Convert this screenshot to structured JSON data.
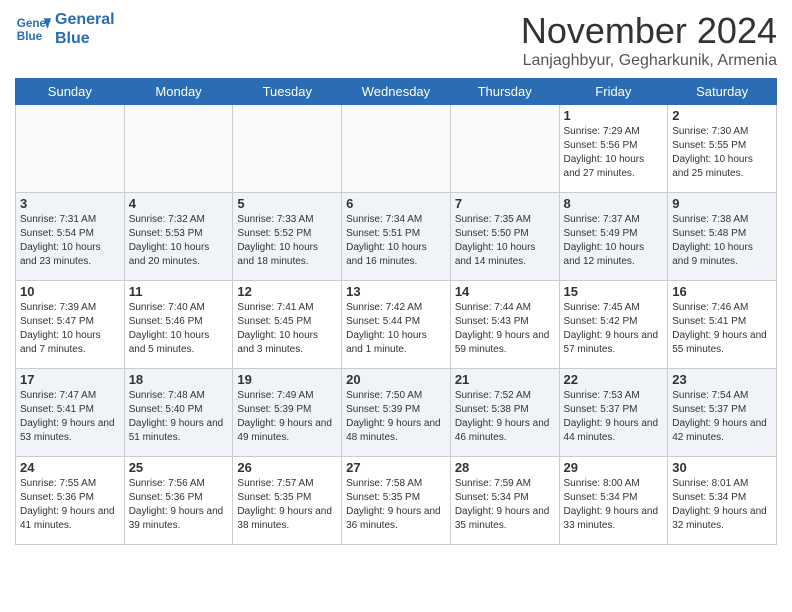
{
  "header": {
    "logo_line1": "General",
    "logo_line2": "Blue",
    "month": "November 2024",
    "location": "Lanjaghbyur, Gegharkunik, Armenia"
  },
  "weekdays": [
    "Sunday",
    "Monday",
    "Tuesday",
    "Wednesday",
    "Thursday",
    "Friday",
    "Saturday"
  ],
  "weeks": [
    [
      {
        "day": "",
        "info": ""
      },
      {
        "day": "",
        "info": ""
      },
      {
        "day": "",
        "info": ""
      },
      {
        "day": "",
        "info": ""
      },
      {
        "day": "",
        "info": ""
      },
      {
        "day": "1",
        "info": "Sunrise: 7:29 AM\nSunset: 5:56 PM\nDaylight: 10 hours and 27 minutes."
      },
      {
        "day": "2",
        "info": "Sunrise: 7:30 AM\nSunset: 5:55 PM\nDaylight: 10 hours and 25 minutes."
      }
    ],
    [
      {
        "day": "3",
        "info": "Sunrise: 7:31 AM\nSunset: 5:54 PM\nDaylight: 10 hours and 23 minutes."
      },
      {
        "day": "4",
        "info": "Sunrise: 7:32 AM\nSunset: 5:53 PM\nDaylight: 10 hours and 20 minutes."
      },
      {
        "day": "5",
        "info": "Sunrise: 7:33 AM\nSunset: 5:52 PM\nDaylight: 10 hours and 18 minutes."
      },
      {
        "day": "6",
        "info": "Sunrise: 7:34 AM\nSunset: 5:51 PM\nDaylight: 10 hours and 16 minutes."
      },
      {
        "day": "7",
        "info": "Sunrise: 7:35 AM\nSunset: 5:50 PM\nDaylight: 10 hours and 14 minutes."
      },
      {
        "day": "8",
        "info": "Sunrise: 7:37 AM\nSunset: 5:49 PM\nDaylight: 10 hours and 12 minutes."
      },
      {
        "day": "9",
        "info": "Sunrise: 7:38 AM\nSunset: 5:48 PM\nDaylight: 10 hours and 9 minutes."
      }
    ],
    [
      {
        "day": "10",
        "info": "Sunrise: 7:39 AM\nSunset: 5:47 PM\nDaylight: 10 hours and 7 minutes."
      },
      {
        "day": "11",
        "info": "Sunrise: 7:40 AM\nSunset: 5:46 PM\nDaylight: 10 hours and 5 minutes."
      },
      {
        "day": "12",
        "info": "Sunrise: 7:41 AM\nSunset: 5:45 PM\nDaylight: 10 hours and 3 minutes."
      },
      {
        "day": "13",
        "info": "Sunrise: 7:42 AM\nSunset: 5:44 PM\nDaylight: 10 hours and 1 minute."
      },
      {
        "day": "14",
        "info": "Sunrise: 7:44 AM\nSunset: 5:43 PM\nDaylight: 9 hours and 59 minutes."
      },
      {
        "day": "15",
        "info": "Sunrise: 7:45 AM\nSunset: 5:42 PM\nDaylight: 9 hours and 57 minutes."
      },
      {
        "day": "16",
        "info": "Sunrise: 7:46 AM\nSunset: 5:41 PM\nDaylight: 9 hours and 55 minutes."
      }
    ],
    [
      {
        "day": "17",
        "info": "Sunrise: 7:47 AM\nSunset: 5:41 PM\nDaylight: 9 hours and 53 minutes."
      },
      {
        "day": "18",
        "info": "Sunrise: 7:48 AM\nSunset: 5:40 PM\nDaylight: 9 hours and 51 minutes."
      },
      {
        "day": "19",
        "info": "Sunrise: 7:49 AM\nSunset: 5:39 PM\nDaylight: 9 hours and 49 minutes."
      },
      {
        "day": "20",
        "info": "Sunrise: 7:50 AM\nSunset: 5:39 PM\nDaylight: 9 hours and 48 minutes."
      },
      {
        "day": "21",
        "info": "Sunrise: 7:52 AM\nSunset: 5:38 PM\nDaylight: 9 hours and 46 minutes."
      },
      {
        "day": "22",
        "info": "Sunrise: 7:53 AM\nSunset: 5:37 PM\nDaylight: 9 hours and 44 minutes."
      },
      {
        "day": "23",
        "info": "Sunrise: 7:54 AM\nSunset: 5:37 PM\nDaylight: 9 hours and 42 minutes."
      }
    ],
    [
      {
        "day": "24",
        "info": "Sunrise: 7:55 AM\nSunset: 5:36 PM\nDaylight: 9 hours and 41 minutes."
      },
      {
        "day": "25",
        "info": "Sunrise: 7:56 AM\nSunset: 5:36 PM\nDaylight: 9 hours and 39 minutes."
      },
      {
        "day": "26",
        "info": "Sunrise: 7:57 AM\nSunset: 5:35 PM\nDaylight: 9 hours and 38 minutes."
      },
      {
        "day": "27",
        "info": "Sunrise: 7:58 AM\nSunset: 5:35 PM\nDaylight: 9 hours and 36 minutes."
      },
      {
        "day": "28",
        "info": "Sunrise: 7:59 AM\nSunset: 5:34 PM\nDaylight: 9 hours and 35 minutes."
      },
      {
        "day": "29",
        "info": "Sunrise: 8:00 AM\nSunset: 5:34 PM\nDaylight: 9 hours and 33 minutes."
      },
      {
        "day": "30",
        "info": "Sunrise: 8:01 AM\nSunset: 5:34 PM\nDaylight: 9 hours and 32 minutes."
      }
    ]
  ]
}
